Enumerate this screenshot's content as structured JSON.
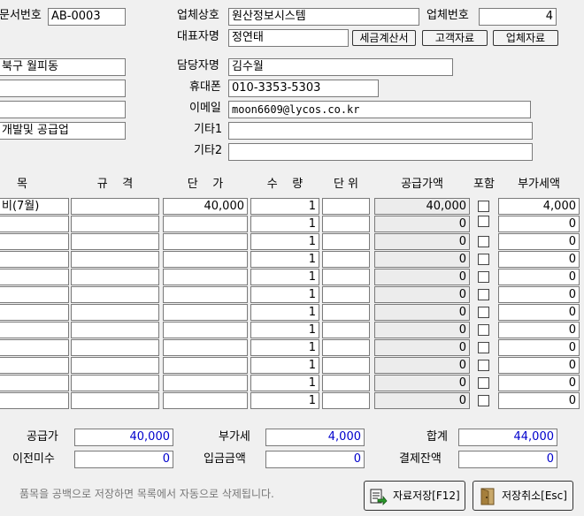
{
  "header": {
    "doc_no_label": "문서번호",
    "doc_no": "AB-0003",
    "company_name_label": "업체상호",
    "company_name": "원산정보시스템",
    "company_no_label": "업체번호",
    "company_no": "4",
    "ceo_label": "대표자명",
    "ceo": "정연태",
    "tax_invoice_btn": "세금계산서",
    "customer_btn": "고객자료",
    "vendor_btn": "업체자료",
    "address": "북구 월피동",
    "blank1": "",
    "blank2": "",
    "business_type": "개발및 공급업",
    "manager_label": "담당자명",
    "manager": "김수월",
    "mobile_label": "휴대폰",
    "mobile": "010-3353-5303",
    "email_label": "이메일",
    "email": "moon6609@lycos.co.kr",
    "etc1_label": "기타1",
    "etc1": "",
    "etc2_label": "기타2",
    "etc2": ""
  },
  "table": {
    "headers": {
      "item": "목",
      "spec": "규    격",
      "price": "단    가",
      "qty": "수    량",
      "unit": "단 위",
      "supply": "공급가액",
      "include": "포함",
      "vat": "부가세액"
    },
    "rows": [
      {
        "item": "비(7월)",
        "spec": "",
        "price": "40,000",
        "qty": "1",
        "unit": "",
        "supply": "40,000",
        "vat": "4,000"
      },
      {
        "item": "",
        "spec": "",
        "price": "",
        "qty": "1",
        "unit": "",
        "supply": "0",
        "vat": "0"
      },
      {
        "item": "",
        "spec": "",
        "price": "",
        "qty": "1",
        "unit": "",
        "supply": "0",
        "vat": "0"
      },
      {
        "item": "",
        "spec": "",
        "price": "",
        "qty": "1",
        "unit": "",
        "supply": "0",
        "vat": "0"
      },
      {
        "item": "",
        "spec": "",
        "price": "",
        "qty": "1",
        "unit": "",
        "supply": "0",
        "vat": "0"
      },
      {
        "item": "",
        "spec": "",
        "price": "",
        "qty": "1",
        "unit": "",
        "supply": "0",
        "vat": "0"
      },
      {
        "item": "",
        "spec": "",
        "price": "",
        "qty": "1",
        "unit": "",
        "supply": "0",
        "vat": "0"
      },
      {
        "item": "",
        "spec": "",
        "price": "",
        "qty": "1",
        "unit": "",
        "supply": "0",
        "vat": "0"
      },
      {
        "item": "",
        "spec": "",
        "price": "",
        "qty": "1",
        "unit": "",
        "supply": "0",
        "vat": "0"
      },
      {
        "item": "",
        "spec": "",
        "price": "",
        "qty": "1",
        "unit": "",
        "supply": "0",
        "vat": "0"
      },
      {
        "item": "",
        "spec": "",
        "price": "",
        "qty": "1",
        "unit": "",
        "supply": "0",
        "vat": "0"
      },
      {
        "item": "",
        "spec": "",
        "price": "",
        "qty": "1",
        "unit": "",
        "supply": "0",
        "vat": "0"
      }
    ]
  },
  "totals": {
    "supply_label": "공급가",
    "supply": "40,000",
    "vat_label": "부가세",
    "vat": "4,000",
    "sum_label": "합계",
    "sum": "44,000",
    "prev_unpaid_label": "이전미수",
    "prev_unpaid": "0",
    "deposit_label": "입금금액",
    "deposit": "0",
    "balance_label": "결제잔액",
    "balance": "0"
  },
  "footer": {
    "note": "품목을 공백으로 저장하면 목록에서 자동으로 삭제됩니다.",
    "save_btn": "자료저장[F12]",
    "cancel_btn": "저장취소[Esc]"
  }
}
